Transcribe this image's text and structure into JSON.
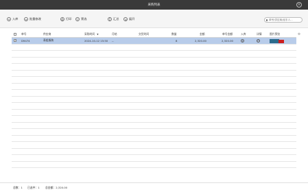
{
  "window": {
    "title": "采购列表",
    "close_glyph": "×"
  },
  "toolbar": {
    "buttons": [
      {
        "label": "入库",
        "glyph": "+"
      },
      {
        "label": "批量修改",
        "glyph": "≡"
      },
      {
        "label": "打印",
        "glyph": "⎙"
      },
      {
        "label": "筛选",
        "glyph": "▽"
      },
      {
        "label": "汇总",
        "glyph": "Σ"
      },
      {
        "label": "展开",
        "glyph": "⇲"
      }
    ],
    "search_placeholder": "单号/供应商/经手人..."
  },
  "table": {
    "columns": [
      "单号",
      "供应商",
      "采购时间",
      "月结",
      "交货时间",
      "数量",
      "金额",
      "单号金额",
      "入库",
      "详情",
      "图片预览"
    ],
    "sort_indicator": "▼",
    "rows": [
      {
        "checked": "✓",
        "id": "D9474",
        "supplier": "表姐服装",
        "time": "2024-10-12 15:50",
        "monthly": "--",
        "delivery": "",
        "qty": "8",
        "amount": "2,320.00",
        "order_amount": "2,320.00",
        "stock_glyph": "+",
        "detail_glyph": "○"
      }
    ]
  },
  "footer": {
    "count_label": "总数：",
    "count": "1",
    "selected_label": "已选中：",
    "selected": "1",
    "total_label": "总金额：",
    "total": "2,320.00"
  }
}
